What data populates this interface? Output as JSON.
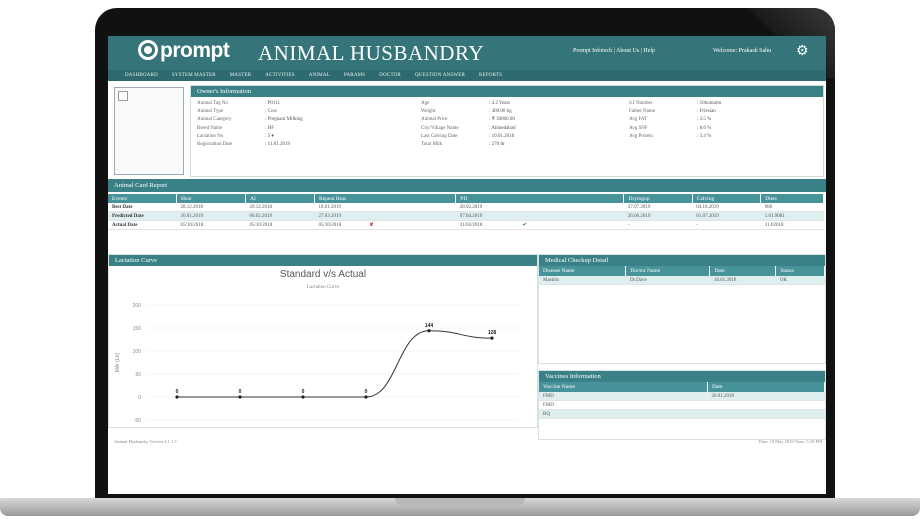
{
  "header": {
    "logo_text": "prompt",
    "app_title": "ANIMAL HUSBANDRY",
    "top_links": "Prompt Infotech | About Us | Help",
    "welcome": "Welcome: Prakash Sahu"
  },
  "nav": [
    "DASHBOARD",
    "SYSTEM MASTER",
    "MASTER",
    "ACTIVITIES",
    "ANIMAL",
    "PARAMS",
    "DOCTOR",
    "QUESTION ANSWER",
    "REPORTS"
  ],
  "owner": {
    "title": "Owner's Information",
    "col1": [
      {
        "k": "Animal Tag No",
        "v": ": P0111"
      },
      {
        "k": "Animal Type",
        "v": ": Cow"
      },
      {
        "k": "Animal Category",
        "v": ": Pregnant Milking"
      },
      {
        "k": "Breed Name",
        "v": ": HF"
      },
      {
        "k": "Lactation No",
        "v": ": 5 ▾"
      },
      {
        "k": "Registration Date",
        "v": ": 11.01.2019"
      }
    ],
    "col2": [
      {
        "k": "Age",
        "v": ": 4.2 Years"
      },
      {
        "k": "Weight",
        "v": ": 400.00 kg"
      },
      {
        "k": "Animal Price",
        "v": ": ₹ 30000.00"
      },
      {
        "k": "City/Village Name",
        "v": ": Ahmedabad"
      },
      {
        "k": "Last Calving Date",
        "v": ": 10.01.2018"
      },
      {
        "k": "Total Milk",
        "v": ": 270 ltr"
      }
    ],
    "col3": [
      {
        "k": "S.I Number",
        "v": ": 10kumarm"
      },
      {
        "k": "Father Name",
        "v": ": Friesian"
      },
      {
        "k": "Avg FAT",
        "v": ": 3.5 %"
      },
      {
        "k": "Avg SNF",
        "v": ": 8.6 %"
      },
      {
        "k": "Avg Protein",
        "v": ": 3.4 %"
      }
    ]
  },
  "card_report": {
    "title": "Animal Card Report",
    "headers": [
      "Events",
      "Heat",
      "AI",
      "Repeat Heat",
      "PD",
      "Dryingup",
      "Calving",
      "Diets"
    ],
    "rows": [
      {
        "label": "Best Date",
        "cells": [
          "28.12.2018",
          "29.12.2018",
          "18.01.2019",
          "28.02.2019",
          "27.07.2019",
          "04.10.2019",
          "986"
        ]
      },
      {
        "label": "Predicted Date",
        "cells": [
          "30.01.2019",
          "06.02.2019",
          "27.03.2019",
          "07.04.2019",
          "26.06.2019",
          "01.07.2019",
          "1.01.9081"
        ]
      },
      {
        "label": "Actual Date",
        "cells": [
          "05/10/2018",
          "05/10/2018",
          "05/10/2018",
          "31/02/2018",
          "-",
          "-",
          "31.02018"
        ]
      }
    ],
    "x_mark": "✘",
    "check_mark": "✔"
  },
  "lactation": {
    "title": "Lactation Curve"
  },
  "chart_data": {
    "type": "line",
    "title": "Standard v/s Actual",
    "subtitle": "Lactation Curve",
    "ylabel": "Milk (Ltr)",
    "yticks": [
      "200",
      "150",
      "100",
      "50",
      "0",
      "-50"
    ],
    "ylim": [
      -50,
      200
    ],
    "x": [
      1,
      2,
      3,
      4,
      5,
      6
    ],
    "series": [
      {
        "values": [
          0,
          0,
          0,
          0,
          144,
          128
        ],
        "labels": [
          "0",
          "0",
          "0",
          "0",
          "144",
          "128"
        ]
      }
    ]
  },
  "medical": {
    "title": "Medical Checkup Detail",
    "headers": [
      "Disease Name",
      "Doctor Name",
      "Date",
      "Status"
    ],
    "rows": [
      [
        "Mastitis",
        "Dr.Dave",
        "18.01.2018",
        "OK"
      ]
    ]
  },
  "vaccines": {
    "title": "Vaccines Information",
    "headers": [
      "Vaccine Name",
      "Date"
    ],
    "rows": [
      [
        "FMD",
        "20.01.2018"
      ],
      [
        "FMD",
        ""
      ],
      [
        "BQ",
        ""
      ]
    ]
  },
  "footer": {
    "left": "Animal Husbandry Version 4.1.1.7",
    "right": "Date: 19 May 2019    Time: 5:18 PM"
  },
  "colors": {
    "primary": "#35757a",
    "table_head": "#47939a",
    "row_alt": "#dfeeee"
  }
}
